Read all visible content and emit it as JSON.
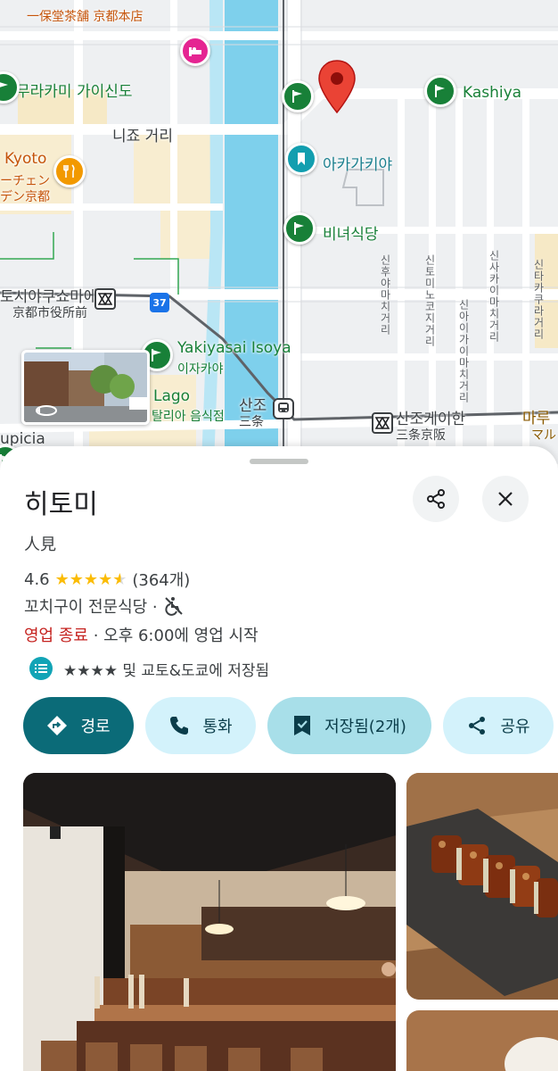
{
  "map": {
    "labels": {
      "ippodo": "一保堂茶舗 京都本店",
      "murakami": "무라카미 가이신도",
      "nijo": "니죠 거리",
      "kashiya": "Kashiya",
      "akagakiya": "아카가키야",
      "binyeo": "비녀식당",
      "kyoto": "Kyoto",
      "chain": "ーチェン",
      "den_kyoto": "デン京都",
      "shiyakusho_kr": "토시야쿠쇼마에",
      "shiyakusho_jp": "京都市役所前",
      "route": "37",
      "yakiyasai": "Yakiyasai Isoya",
      "izakaya": "이자카야",
      "lago": "Lago",
      "italian": "탈리아 음식점",
      "sanjo_kr": "산조",
      "sanjo_jp": "三条",
      "sanjo_keihan_kr": "산조케이한",
      "sanjo_keihan_jp": "三条京阪",
      "maru_kr": "마루",
      "maru_jp": "マルコ",
      "upicia": "upicia",
      "street1": "신후야마치거리",
      "street2": "신토미노코지거리",
      "street3": "신아이가이마치거리",
      "street4": "신사카이마치거리",
      "street5": "신타카쿠라거리"
    }
  },
  "place": {
    "name": "히토미",
    "original_name": "人見",
    "rating": "4.6",
    "stars": 4.6,
    "review_count": "(364개)",
    "category": "꼬치구이 전문식당 ·",
    "status_closed": "영업 종료",
    "hours_rest": " · 오후 6:00에 영업 시작",
    "saved_in": "★★★★ 및 교토&도쿄에 저장됨"
  },
  "actions": {
    "directions": "경로",
    "call": "통화",
    "saved": "저장됨(2개)",
    "share": "공유"
  },
  "colors": {
    "accent": "#0b6b78",
    "chip_light": "#d3f2fb",
    "chip_selected": "#a8dfe9",
    "star": "#fbbc04",
    "closed": "#c5221f",
    "pin_red": "#ea4335",
    "pin_green": "#188038"
  }
}
